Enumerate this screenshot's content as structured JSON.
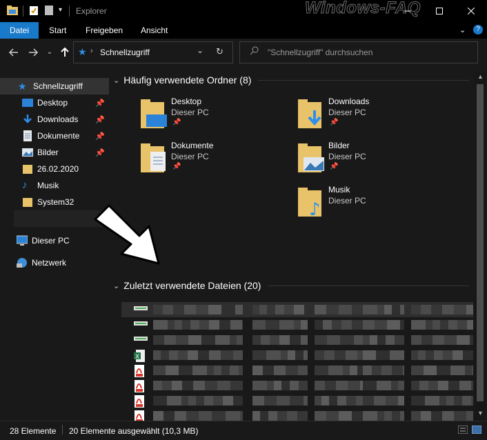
{
  "window": {
    "title": "Explorer",
    "watermark": "Windows-FAQ"
  },
  "ribbon": {
    "tabs": [
      {
        "label": "Datei",
        "active": true
      },
      {
        "label": "Start",
        "active": false
      },
      {
        "label": "Freigeben",
        "active": false
      },
      {
        "label": "Ansicht",
        "active": false
      }
    ]
  },
  "address": {
    "location": "Schnellzugriff",
    "search_placeholder": "\"Schnellzugriff\" durchsuchen"
  },
  "sidebar": {
    "items": [
      {
        "label": "Schnellzugriff",
        "icon": "star-icon",
        "pinned": false
      },
      {
        "label": "Desktop",
        "icon": "desktop-icon",
        "pinned": true
      },
      {
        "label": "Downloads",
        "icon": "download-icon",
        "pinned": true
      },
      {
        "label": "Dokumente",
        "icon": "document-icon",
        "pinned": true
      },
      {
        "label": "Bilder",
        "icon": "pictures-icon",
        "pinned": true
      },
      {
        "label": "26.02.2020",
        "icon": "folder-icon",
        "pinned": false
      },
      {
        "label": "Musik",
        "icon": "music-icon",
        "pinned": false
      },
      {
        "label": "System32",
        "icon": "folder-icon",
        "pinned": false
      },
      {
        "label": "Dieser PC",
        "icon": "pc-icon",
        "pinned": false
      },
      {
        "label": "Netzwerk",
        "icon": "network-icon",
        "pinned": false
      }
    ]
  },
  "frequent": {
    "header": "Häufig verwendete Ordner (8)",
    "folders": [
      {
        "name": "Desktop",
        "location": "Dieser PC",
        "pinned": true
      },
      {
        "name": "Downloads",
        "location": "Dieser PC",
        "pinned": true
      },
      {
        "name": "Dokumente",
        "location": "Dieser PC",
        "pinned": true
      },
      {
        "name": "Bilder",
        "location": "Dieser PC",
        "pinned": true
      },
      {
        "name": "Musik",
        "location": "Dieser PC",
        "pinned": false
      }
    ]
  },
  "recent": {
    "header": "Zuletzt verwendete Dateien (20)",
    "files": [
      {
        "icon": "generic-file-icon"
      },
      {
        "icon": "generic-file-icon"
      },
      {
        "icon": "generic-file-icon"
      },
      {
        "icon": "excel-file-icon"
      },
      {
        "icon": "pdf-file-icon"
      },
      {
        "icon": "pdf-file-icon"
      },
      {
        "icon": "pdf-file-icon"
      },
      {
        "icon": "pdf-file-icon"
      },
      {
        "icon": "pdf-file-icon"
      }
    ]
  },
  "status": {
    "count": "28 Elemente",
    "selection": "20 Elemente ausgewählt (10,3 MB)"
  },
  "colors": {
    "accent": "#1979ca",
    "background": "#191919",
    "folder": "#e8c36a"
  }
}
